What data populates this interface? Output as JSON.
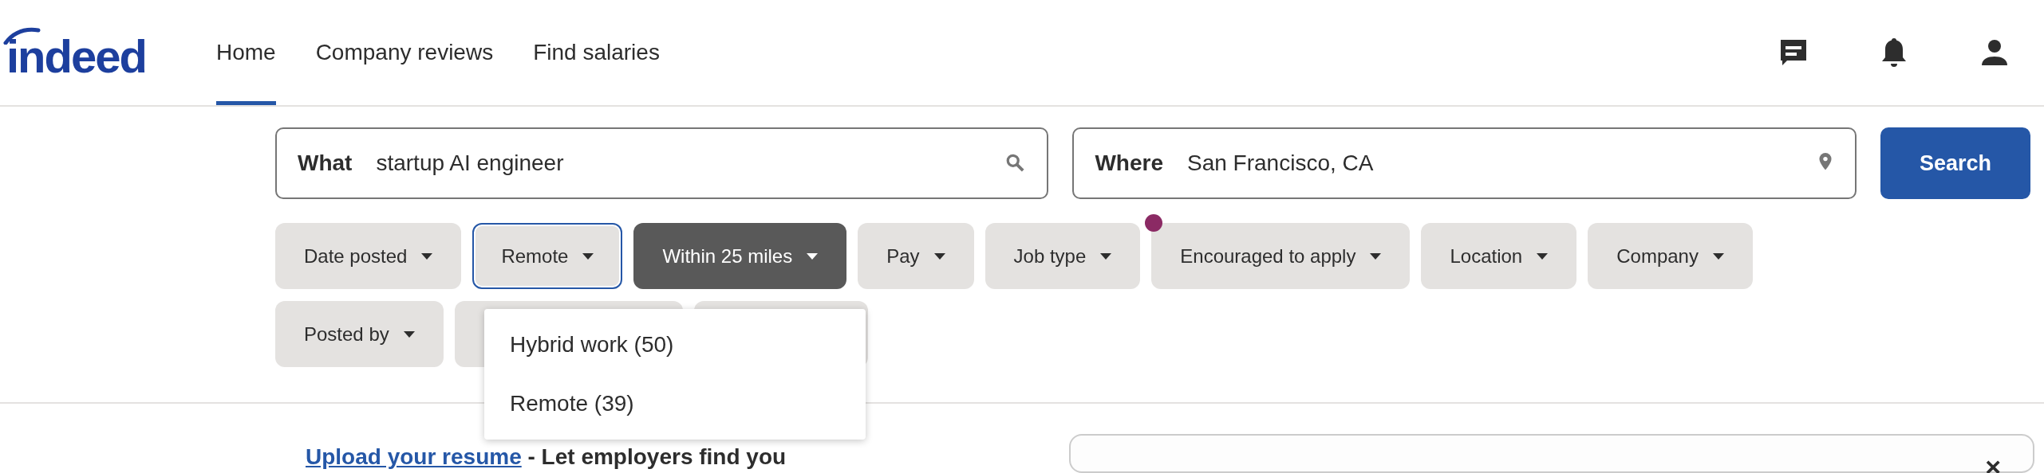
{
  "header": {
    "logo": "indeed",
    "nav": [
      {
        "label": "Home",
        "selected": true
      },
      {
        "label": "Company reviews",
        "selected": false
      },
      {
        "label": "Find salaries",
        "selected": false
      }
    ]
  },
  "search": {
    "what": {
      "label": "What",
      "value": "startup AI engineer"
    },
    "where": {
      "label": "Where",
      "value": "San Francisco, CA"
    },
    "button": "Search"
  },
  "filters": [
    [
      {
        "kind": "chip",
        "label": "Date posted",
        "expanded": false,
        "active": false,
        "indicator": false
      },
      {
        "kind": "chip",
        "label": "Remote",
        "expanded": true,
        "active": false,
        "indicator": false
      },
      {
        "kind": "chip",
        "label": "Within 25 miles",
        "expanded": false,
        "active": true,
        "indicator": false
      },
      {
        "kind": "chip",
        "label": "Pay",
        "expanded": false,
        "active": false,
        "indicator": false
      },
      {
        "kind": "chip",
        "label": "Job type",
        "expanded": false,
        "active": false,
        "indicator": false
      },
      {
        "kind": "chip",
        "label": "Encouraged to apply",
        "expanded": false,
        "active": false,
        "indicator": true
      },
      {
        "kind": "chip",
        "label": "Location",
        "expanded": false,
        "active": false,
        "indicator": false
      },
      {
        "kind": "chip",
        "label": "Company",
        "expanded": false,
        "active": false,
        "indicator": false
      }
    ],
    [
      {
        "kind": "chip",
        "label": "Posted by",
        "expanded": false,
        "active": false,
        "indicator": false
      },
      {
        "kind": "covered"
      },
      {
        "kind": "covered"
      }
    ]
  ],
  "dropdown": {
    "options": [
      "Hybrid work (50)",
      "Remote (39)"
    ]
  },
  "resume_prompt": {
    "link": "Upload your resume",
    "text": " - Let employers find you"
  },
  "side_card": {
    "close": "×"
  }
}
